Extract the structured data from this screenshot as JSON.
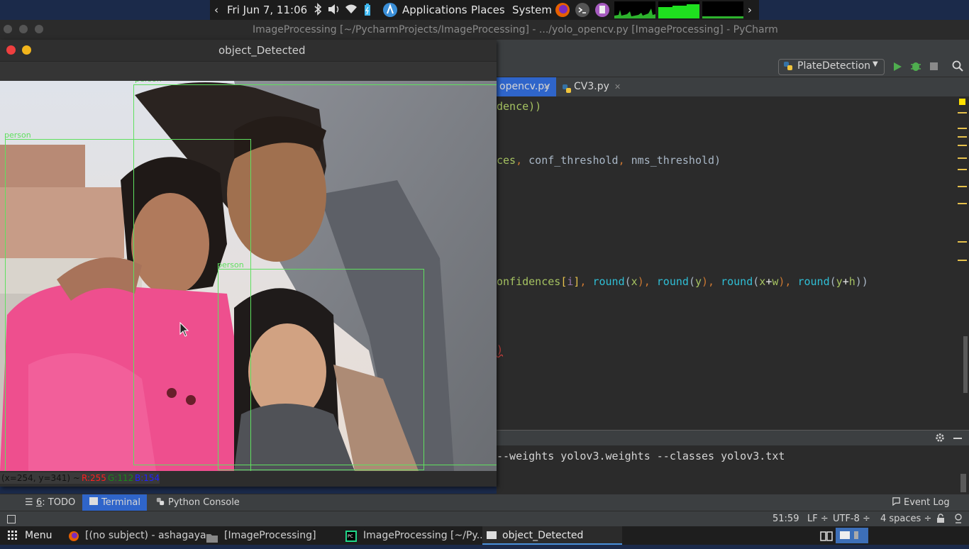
{
  "top_panel": {
    "datetime": "Fri Jun 7, 11:06",
    "applications": "Applications",
    "places": "Places",
    "system": "System"
  },
  "pycharm": {
    "window_title": "ImageProcessing [~/PycharmProjects/ImageProcessing] - .../yolo_opencv.py [ImageProcessing] - PyCharm",
    "run_config": "PlateDetection",
    "tabs": [
      {
        "label": "opencv.py",
        "active": true
      },
      {
        "label": "CV3.py",
        "active": false
      }
    ],
    "code_lines": [
      [
        "dence))"
      ],
      [
        "ces",
        ", ",
        "conf_threshold",
        ", ",
        "nms_threshold)"
      ],
      [
        "onfidences",
        "[",
        "i",
        "]",
        ", ",
        "round",
        "(",
        "x",
        "), ",
        "round",
        "(",
        "y",
        "), ",
        "round",
        "(",
        "x",
        "+",
        "w",
        "), ",
        "round",
        "(",
        "y",
        "+",
        "h",
        "))"
      ],
      [
        ")"
      ]
    ],
    "terminal_line": "--weights yolov3.weights --classes yolov3.txt",
    "tool_tabs": {
      "todo_num": "6",
      "todo": ": TODO",
      "terminal": "Terminal",
      "python_console": "Python Console",
      "event_log": "Event Log"
    },
    "status": {
      "position": "51:59",
      "line_sep": "LF",
      "encoding": "UTF-8",
      "indent": "4 spaces"
    }
  },
  "cv_window": {
    "title": "object_Detected",
    "detections": [
      "person",
      "person",
      "person"
    ],
    "status_coords": "(x=254, y=341) ~",
    "status_r": "R:255",
    "status_g": "G:112",
    "status_b": "B:154"
  },
  "taskbar": {
    "menu": "Menu",
    "items": [
      "[(no subject) - ashagaya...",
      "[ImageProcessing]",
      "ImageProcessing [~/Py...",
      "object_Detected"
    ]
  },
  "colors": {
    "box": "#5fe05f",
    "active_tab": "#2f65ca",
    "keyword_cyan": "#2fbfd6",
    "bracket_yellow": "#e6c14c"
  }
}
